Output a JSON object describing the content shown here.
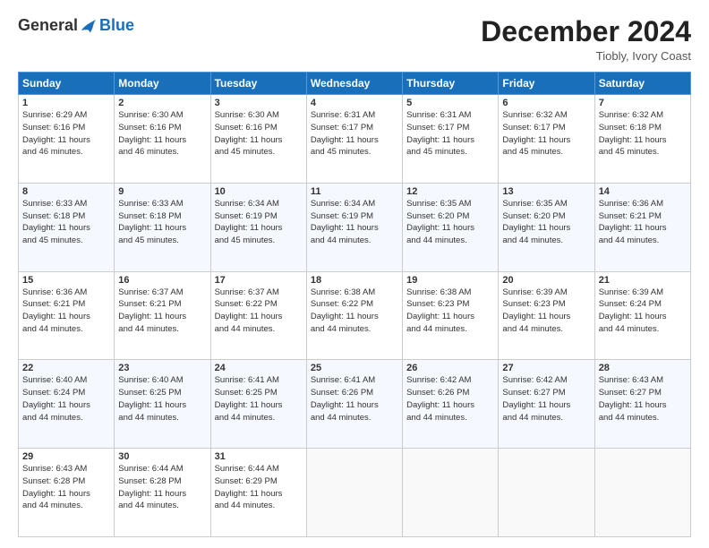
{
  "logo": {
    "general": "General",
    "blue": "Blue"
  },
  "header": {
    "month": "December 2024",
    "location": "Tiobly, Ivory Coast"
  },
  "days_of_week": [
    "Sunday",
    "Monday",
    "Tuesday",
    "Wednesday",
    "Thursday",
    "Friday",
    "Saturday"
  ],
  "weeks": [
    [
      {
        "day": "1",
        "info": "Sunrise: 6:29 AM\nSunset: 6:16 PM\nDaylight: 11 hours\nand 46 minutes."
      },
      {
        "day": "2",
        "info": "Sunrise: 6:30 AM\nSunset: 6:16 PM\nDaylight: 11 hours\nand 46 minutes."
      },
      {
        "day": "3",
        "info": "Sunrise: 6:30 AM\nSunset: 6:16 PM\nDaylight: 11 hours\nand 45 minutes."
      },
      {
        "day": "4",
        "info": "Sunrise: 6:31 AM\nSunset: 6:17 PM\nDaylight: 11 hours\nand 45 minutes."
      },
      {
        "day": "5",
        "info": "Sunrise: 6:31 AM\nSunset: 6:17 PM\nDaylight: 11 hours\nand 45 minutes."
      },
      {
        "day": "6",
        "info": "Sunrise: 6:32 AM\nSunset: 6:17 PM\nDaylight: 11 hours\nand 45 minutes."
      },
      {
        "day": "7",
        "info": "Sunrise: 6:32 AM\nSunset: 6:18 PM\nDaylight: 11 hours\nand 45 minutes."
      }
    ],
    [
      {
        "day": "8",
        "info": "Sunrise: 6:33 AM\nSunset: 6:18 PM\nDaylight: 11 hours\nand 45 minutes."
      },
      {
        "day": "9",
        "info": "Sunrise: 6:33 AM\nSunset: 6:18 PM\nDaylight: 11 hours\nand 45 minutes."
      },
      {
        "day": "10",
        "info": "Sunrise: 6:34 AM\nSunset: 6:19 PM\nDaylight: 11 hours\nand 45 minutes."
      },
      {
        "day": "11",
        "info": "Sunrise: 6:34 AM\nSunset: 6:19 PM\nDaylight: 11 hours\nand 44 minutes."
      },
      {
        "day": "12",
        "info": "Sunrise: 6:35 AM\nSunset: 6:20 PM\nDaylight: 11 hours\nand 44 minutes."
      },
      {
        "day": "13",
        "info": "Sunrise: 6:35 AM\nSunset: 6:20 PM\nDaylight: 11 hours\nand 44 minutes."
      },
      {
        "day": "14",
        "info": "Sunrise: 6:36 AM\nSunset: 6:21 PM\nDaylight: 11 hours\nand 44 minutes."
      }
    ],
    [
      {
        "day": "15",
        "info": "Sunrise: 6:36 AM\nSunset: 6:21 PM\nDaylight: 11 hours\nand 44 minutes."
      },
      {
        "day": "16",
        "info": "Sunrise: 6:37 AM\nSunset: 6:21 PM\nDaylight: 11 hours\nand 44 minutes."
      },
      {
        "day": "17",
        "info": "Sunrise: 6:37 AM\nSunset: 6:22 PM\nDaylight: 11 hours\nand 44 minutes."
      },
      {
        "day": "18",
        "info": "Sunrise: 6:38 AM\nSunset: 6:22 PM\nDaylight: 11 hours\nand 44 minutes."
      },
      {
        "day": "19",
        "info": "Sunrise: 6:38 AM\nSunset: 6:23 PM\nDaylight: 11 hours\nand 44 minutes."
      },
      {
        "day": "20",
        "info": "Sunrise: 6:39 AM\nSunset: 6:23 PM\nDaylight: 11 hours\nand 44 minutes."
      },
      {
        "day": "21",
        "info": "Sunrise: 6:39 AM\nSunset: 6:24 PM\nDaylight: 11 hours\nand 44 minutes."
      }
    ],
    [
      {
        "day": "22",
        "info": "Sunrise: 6:40 AM\nSunset: 6:24 PM\nDaylight: 11 hours\nand 44 minutes."
      },
      {
        "day": "23",
        "info": "Sunrise: 6:40 AM\nSunset: 6:25 PM\nDaylight: 11 hours\nand 44 minutes."
      },
      {
        "day": "24",
        "info": "Sunrise: 6:41 AM\nSunset: 6:25 PM\nDaylight: 11 hours\nand 44 minutes."
      },
      {
        "day": "25",
        "info": "Sunrise: 6:41 AM\nSunset: 6:26 PM\nDaylight: 11 hours\nand 44 minutes."
      },
      {
        "day": "26",
        "info": "Sunrise: 6:42 AM\nSunset: 6:26 PM\nDaylight: 11 hours\nand 44 minutes."
      },
      {
        "day": "27",
        "info": "Sunrise: 6:42 AM\nSunset: 6:27 PM\nDaylight: 11 hours\nand 44 minutes."
      },
      {
        "day": "28",
        "info": "Sunrise: 6:43 AM\nSunset: 6:27 PM\nDaylight: 11 hours\nand 44 minutes."
      }
    ],
    [
      {
        "day": "29",
        "info": "Sunrise: 6:43 AM\nSunset: 6:28 PM\nDaylight: 11 hours\nand 44 minutes."
      },
      {
        "day": "30",
        "info": "Sunrise: 6:44 AM\nSunset: 6:28 PM\nDaylight: 11 hours\nand 44 minutes."
      },
      {
        "day": "31",
        "info": "Sunrise: 6:44 AM\nSunset: 6:29 PM\nDaylight: 11 hours\nand 44 minutes."
      },
      {
        "day": "",
        "info": ""
      },
      {
        "day": "",
        "info": ""
      },
      {
        "day": "",
        "info": ""
      },
      {
        "day": "",
        "info": ""
      }
    ]
  ]
}
